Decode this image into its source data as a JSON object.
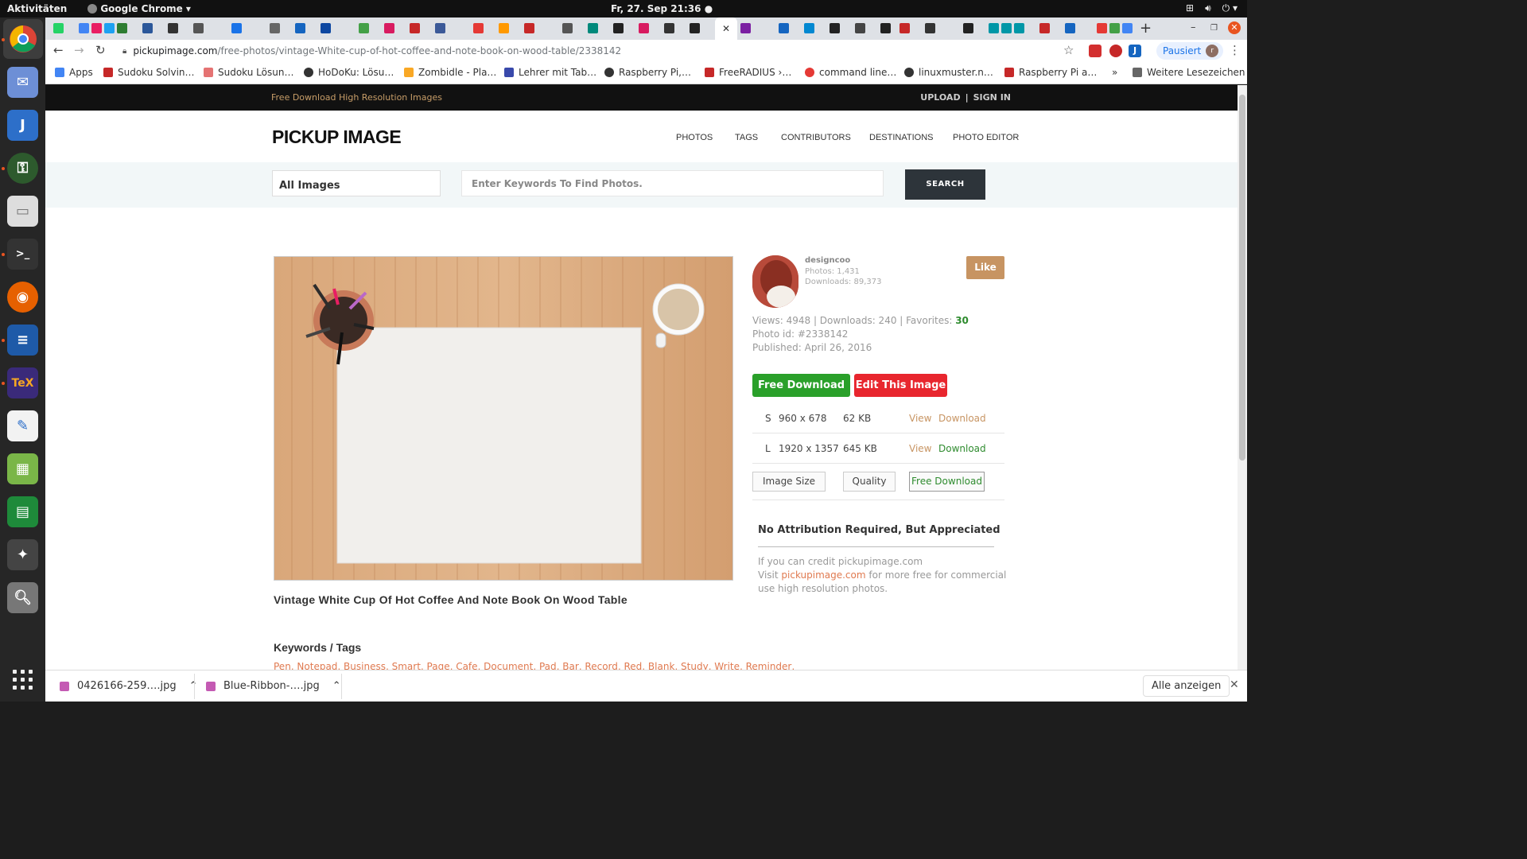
{
  "system": {
    "activities": "Aktivitäten",
    "app_name": "Google Chrome",
    "clock": "Fr, 27. Sep  21:36"
  },
  "browser": {
    "url_domain": "pickupimage.com",
    "url_path": "/free-photos/vintage-White-cup-of-hot-coffee-and-note-book-on-wood-table/2338142",
    "profile_label": "Pausiert",
    "profile_initial": "r",
    "bookmarks": [
      "Apps",
      "Sudoku Solvin…",
      "Sudoku Lösun…",
      "HoDoKu: Lösu…",
      "Zombidle - Pla…",
      "Lehrer mit Tab…",
      "Raspberry Pi,…",
      "FreeRADIUS ›…",
      "command line…",
      "linuxmuster.n…",
      "Raspberry Pi a…"
    ],
    "bookmarks_more": "»",
    "other_bookmarks": "Weitere Lesezeichen"
  },
  "site": {
    "tagline": "Free Download High Resolution Images",
    "upload": "UPLOAD",
    "signin": "SIGN IN",
    "logo": "PICKUP IMAGE",
    "nav": [
      "PHOTOS",
      "TAGS",
      "CONTRIBUTORS",
      "DESTINATIONS",
      "PHOTO EDITOR"
    ],
    "search": {
      "category": "All Images",
      "placeholder": "Enter Keywords To Find Photos.",
      "button": "SEARCH"
    }
  },
  "photo": {
    "title": "Vintage White Cup Of Hot Coffee And Note Book On Wood Table",
    "keywords_heading": "Keywords / Tags",
    "keywords": "Pen, Notepad, Business, Smart, Page, Cafe, Document, Pad, Bar, Record, Red, Blank, Study, Write, Reminder,"
  },
  "author": {
    "name": "designcoo",
    "photos": "Photos: 1,431",
    "downloads": "Downloads: 89,373",
    "like": "Like"
  },
  "stats": {
    "line1_prefix": "Views: 4948 | Downloads: 240 | Favorites: ",
    "favorites": "30",
    "photo_id": "Photo id: #2338142",
    "published": "Published: April 26, 2016"
  },
  "actions": {
    "free_download": "Free Download",
    "edit_image": "Edit This Image"
  },
  "sizes": [
    {
      "code": "S",
      "dims": "960 x 678",
      "size": "62 KB",
      "view": "View",
      "download": "Download"
    },
    {
      "code": "L",
      "dims": "1920 x 1357",
      "size": "645 KB",
      "view": "View",
      "download": "Download"
    }
  ],
  "options": {
    "image_size": "Image Size",
    "quality": "Quality",
    "free_download": "Free Download"
  },
  "attribution": {
    "heading": "No Attribution Required, But Appreciated",
    "line1": "If you can credit pickupimage.com",
    "line2_prefix": "Visit ",
    "line2_link": "pickupimage.com",
    "line2_suffix": " for more free for commercial",
    "line3": "use high resolution photos."
  },
  "downloads_bar": {
    "items": [
      "0426166-259….jpg",
      "Blue-Ribbon-….jpg"
    ],
    "show_all": "Alle anzeigen"
  },
  "colors": {
    "accent_brown": "#c79462",
    "download_green": "#2aa02a",
    "edit_red": "#e8262e",
    "link_orange": "#e07a50"
  }
}
